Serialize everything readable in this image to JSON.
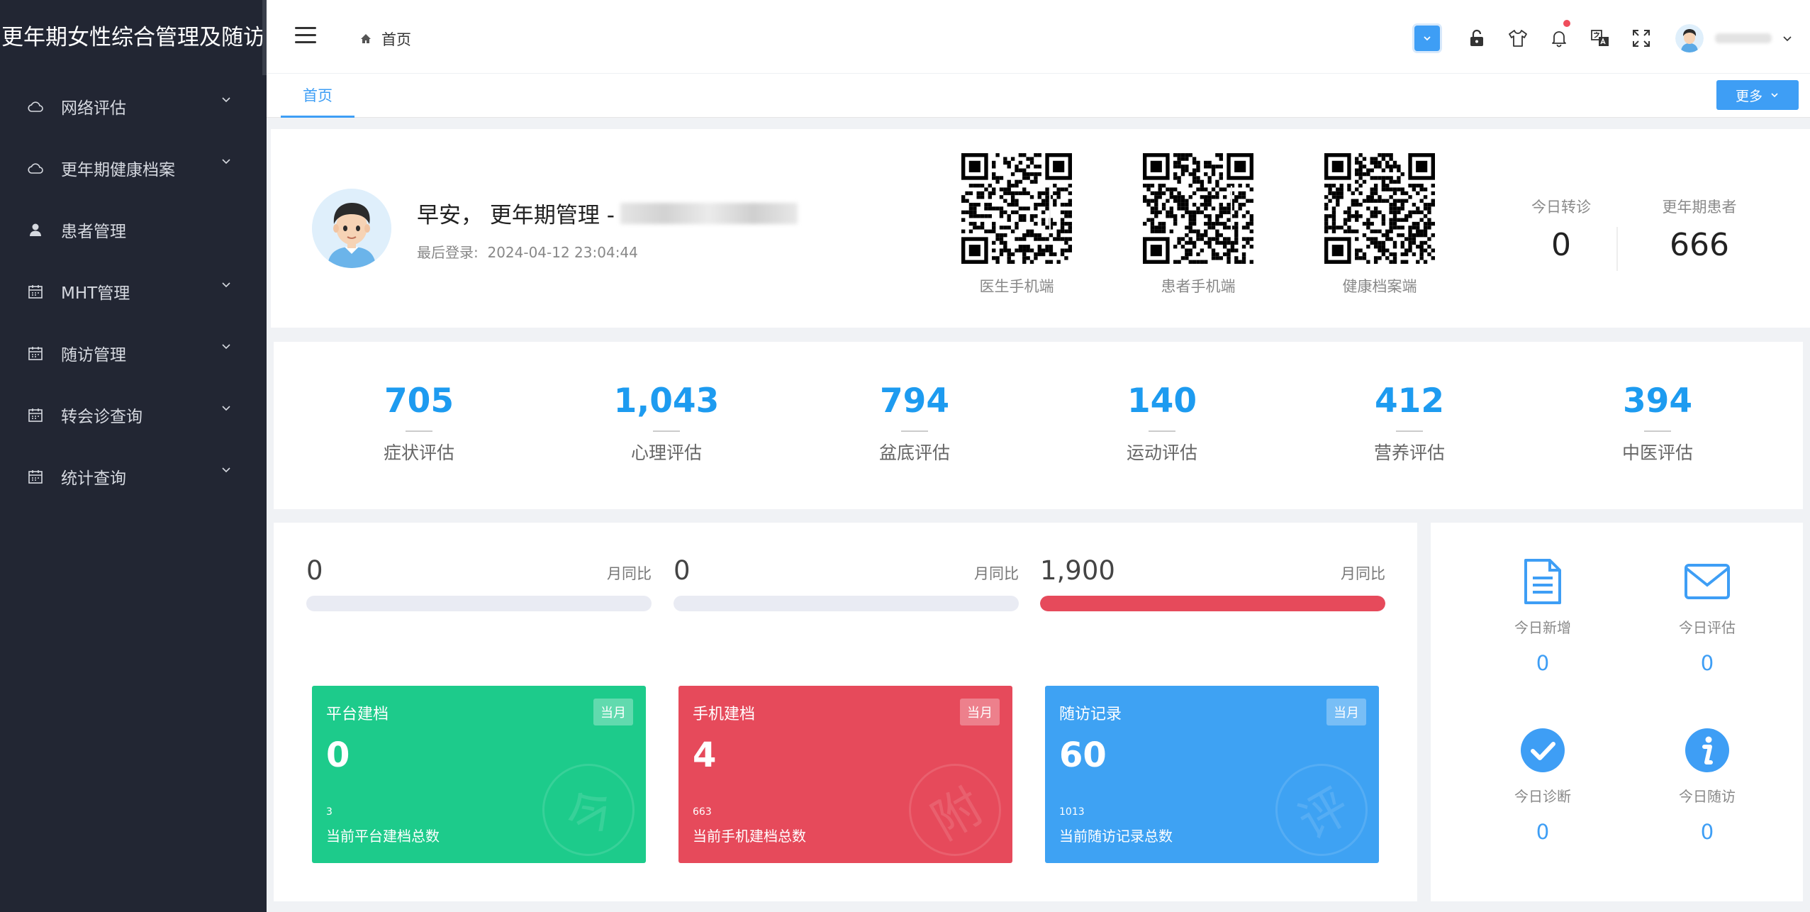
{
  "app": {
    "title": "更年期女性综合管理及随访"
  },
  "sidebar": {
    "items": [
      {
        "label": "网络评估",
        "icon": "cloud-icon",
        "expandable": true
      },
      {
        "label": "更年期健康档案",
        "icon": "cloud-icon",
        "expandable": true
      },
      {
        "label": "患者管理",
        "icon": "user-icon",
        "expandable": false
      },
      {
        "label": "MHT管理",
        "icon": "calendar-icon",
        "expandable": true
      },
      {
        "label": "随访管理",
        "icon": "calendar-icon",
        "expandable": true
      },
      {
        "label": "转会诊查询",
        "icon": "calendar-icon",
        "expandable": true
      },
      {
        "label": "统计查询",
        "icon": "calendar-icon",
        "expandable": true
      }
    ]
  },
  "header": {
    "breadcrumb": "首页"
  },
  "tabs": {
    "active": "首页",
    "more_label": "更多"
  },
  "profile": {
    "greeting": "早安， 更年期管理 -",
    "last_login_label": "最后登录:",
    "last_login_value": "2024-04-12 23:04:44",
    "qrcodes": [
      {
        "label": "医生手机端"
      },
      {
        "label": "患者手机端"
      },
      {
        "label": "健康档案端"
      }
    ],
    "kpis": [
      {
        "label": "今日转诊",
        "value": "0"
      },
      {
        "label": "更年期患者",
        "value": "666"
      }
    ]
  },
  "stats": [
    {
      "value": "705",
      "label": "症状评估"
    },
    {
      "value": "1,043",
      "label": "心理评估"
    },
    {
      "value": "794",
      "label": "盆底评估"
    },
    {
      "value": "140",
      "label": "运动评估"
    },
    {
      "value": "412",
      "label": "营养评估"
    },
    {
      "value": "394",
      "label": "中医评估"
    }
  ],
  "progress": [
    {
      "value": "0",
      "label": "月同比",
      "fill": 0
    },
    {
      "value": "0",
      "label": "月同比",
      "fill": 0
    },
    {
      "value": "1,900",
      "label": "月同比",
      "fill": 1.0
    }
  ],
  "cards": [
    {
      "title": "平台建档",
      "badge": "当月",
      "value": "0",
      "sub_value": "3",
      "sub_label": "当前平台建档总数",
      "watermark": "今",
      "color": "#1dcb8b"
    },
    {
      "title": "手机建档",
      "badge": "当月",
      "value": "4",
      "sub_value": "663",
      "sub_label": "当前手机建档总数",
      "watermark": "附",
      "color": "#e64a5b"
    },
    {
      "title": "随访记录",
      "badge": "当月",
      "value": "60",
      "sub_value": "1013",
      "sub_label": "当前随访记录总数",
      "watermark": "评",
      "color": "#3ea2f3"
    }
  ],
  "today": [
    {
      "label": "今日新增",
      "value": "0",
      "icon": "document-icon"
    },
    {
      "label": "今日评估",
      "value": "0",
      "icon": "mail-icon"
    },
    {
      "label": "今日诊断",
      "value": "0",
      "icon": "check-circle-icon"
    },
    {
      "label": "今日随访",
      "value": "0",
      "icon": "info-circle-icon"
    }
  ],
  "colors": {
    "sidebar_bg": "#222633",
    "accent": "#3e9ef5",
    "stat_number": "#1d9bf0",
    "danger": "#e64a5b",
    "success": "#1dcb8b"
  }
}
